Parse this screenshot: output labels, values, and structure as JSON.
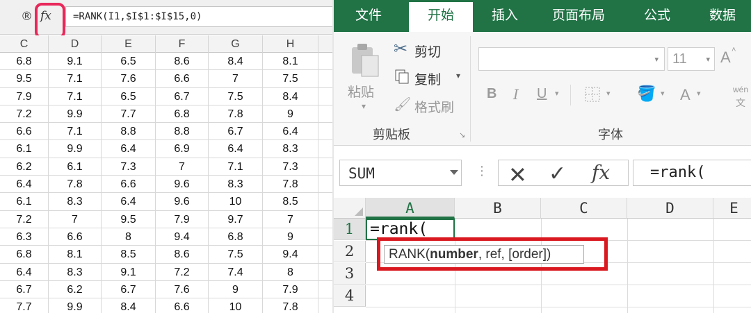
{
  "left_panel": {
    "circle_icon": "®",
    "fx_label": "fx",
    "formula": "=RANK(I1,$I$1:$I$15,0)",
    "columns": [
      "C",
      "D",
      "E",
      "F",
      "G",
      "H"
    ],
    "rows": [
      [
        "6.8",
        "9.1",
        "6.5",
        "8.6",
        "8.4",
        "8.1"
      ],
      [
        "9.5",
        "7.1",
        "7.6",
        "6.6",
        "7",
        "7.5"
      ],
      [
        "7.9",
        "7.1",
        "6.5",
        "6.7",
        "7.5",
        "8.4"
      ],
      [
        "7.2",
        "9.9",
        "7.7",
        "6.8",
        "7.8",
        "9"
      ],
      [
        "6.6",
        "7.1",
        "8.8",
        "8.8",
        "6.7",
        "6.4"
      ],
      [
        "6.1",
        "9.9",
        "6.4",
        "6.9",
        "6.4",
        "8.3"
      ],
      [
        "6.2",
        "6.1",
        "7.3",
        "7",
        "7.1",
        "7.3"
      ],
      [
        "6.4",
        "7.8",
        "6.6",
        "9.6",
        "8.3",
        "7.8"
      ],
      [
        "6.1",
        "8.3",
        "6.4",
        "9.6",
        "10",
        "8.5"
      ],
      [
        "7.2",
        "7",
        "9.5",
        "7.9",
        "9.7",
        "7"
      ],
      [
        "6.3",
        "6.6",
        "8",
        "9.4",
        "6.8",
        "9"
      ],
      [
        "6.8",
        "8.1",
        "8.5",
        "8.6",
        "7.5",
        "9.4"
      ],
      [
        "6.4",
        "8.3",
        "9.1",
        "7.2",
        "7.4",
        "8"
      ],
      [
        "6.7",
        "6.2",
        "6.7",
        "7.6",
        "9",
        "7.9"
      ],
      [
        "7.7",
        "9.9",
        "8.4",
        "6.6",
        "10",
        "7.8"
      ]
    ],
    "highlight_color": "#e8285a"
  },
  "ribbon": {
    "tabs": [
      "文件",
      "开始",
      "插入",
      "页面布局",
      "公式",
      "数据"
    ],
    "active_tab": "开始",
    "clipboard": {
      "paste": "粘贴",
      "cut": "剪切",
      "copy": "复制",
      "format_painter": "格式刷",
      "group_label": "剪贴板"
    },
    "font": {
      "size": "11",
      "bold": "B",
      "italic": "I",
      "underline": "U",
      "font_color": "A",
      "grow": "A",
      "phonetic_top": "wén",
      "phonetic_bottom": "文",
      "group_label": "字体"
    },
    "accent": "#217346"
  },
  "formula_bar": {
    "name_box": "SUM",
    "cancel_icon": "✕",
    "enter_icon": "✓",
    "fx_label": "fx",
    "formula": "=rank("
  },
  "sheet": {
    "columns": [
      "A",
      "B",
      "C",
      "D",
      "E"
    ],
    "rows": [
      "1",
      "2",
      "3",
      "4"
    ],
    "active_cell_value": "=rank(",
    "tooltip": {
      "fn": "RANK(",
      "arg1": "number",
      "rest": ", ref, [order])"
    },
    "highlight_color": "#d9191f"
  }
}
